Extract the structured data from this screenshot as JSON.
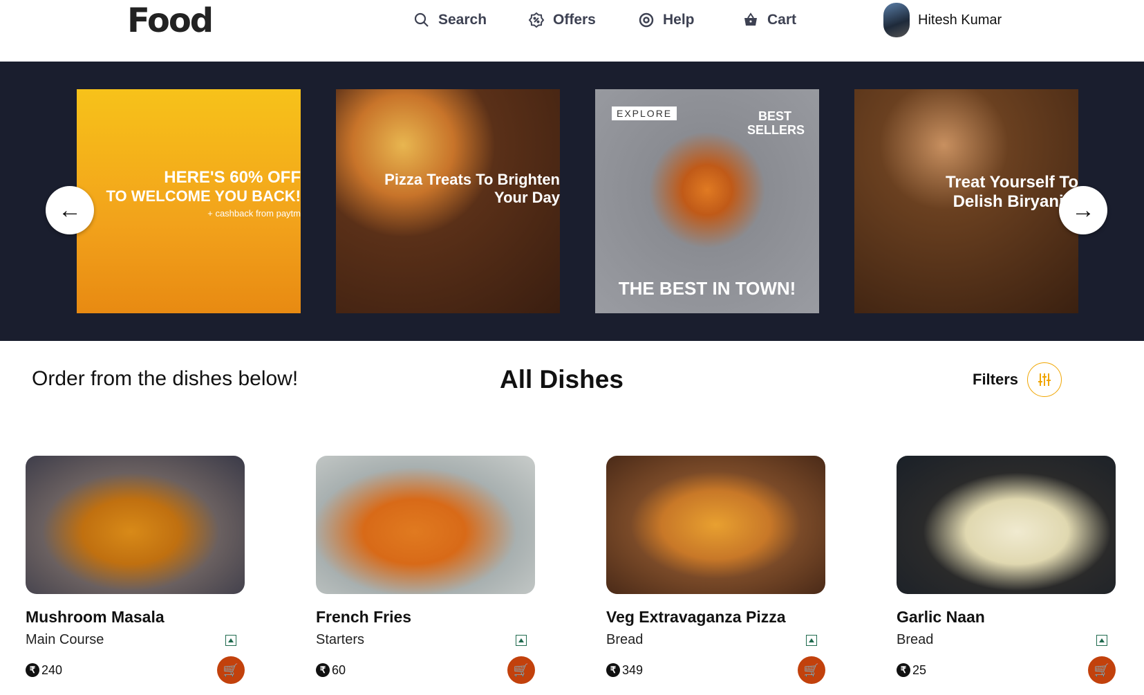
{
  "header": {
    "logo": "Food",
    "nav": [
      {
        "label": "Search",
        "icon": "search-icon"
      },
      {
        "label": "Offers",
        "icon": "offers-icon"
      },
      {
        "label": "Help",
        "icon": "help-icon"
      },
      {
        "label": "Cart",
        "icon": "cart-icon"
      }
    ],
    "user": "Hitesh Kumar"
  },
  "banners": [
    {
      "line1": "HERE'S 60% OFF",
      "line2": "TO WELCOME YOU BACK!",
      "line3": "+ cashback from paytm"
    },
    {
      "line1": "Pizza Treats To Brighten",
      "line2": "Your Day"
    },
    {
      "tag": "EXPLORE",
      "badge": "BEST SELLERS",
      "line1": "THE BEST IN TOWN!"
    },
    {
      "line1": "Treat Yourself To",
      "line2": "Delish Biryanis!"
    }
  ],
  "section": {
    "subtitle": "Order from the dishes below!",
    "title": "All Dishes",
    "filters": "Filters"
  },
  "dishes": [
    {
      "name": "Mushroom Masala",
      "category": "Main Course",
      "price": "240"
    },
    {
      "name": "French Fries",
      "category": "Starters",
      "price": "60"
    },
    {
      "name": "Veg Extravaganza Pizza",
      "category": "Bread",
      "price": "349"
    },
    {
      "name": "Garlic Naan",
      "category": "Bread",
      "price": "25"
    }
  ],
  "colors": {
    "banner_bg": "#1a1e2e",
    "accent": "#c2410c",
    "filter": "#f0a500",
    "veg": "#1f6a4e"
  }
}
